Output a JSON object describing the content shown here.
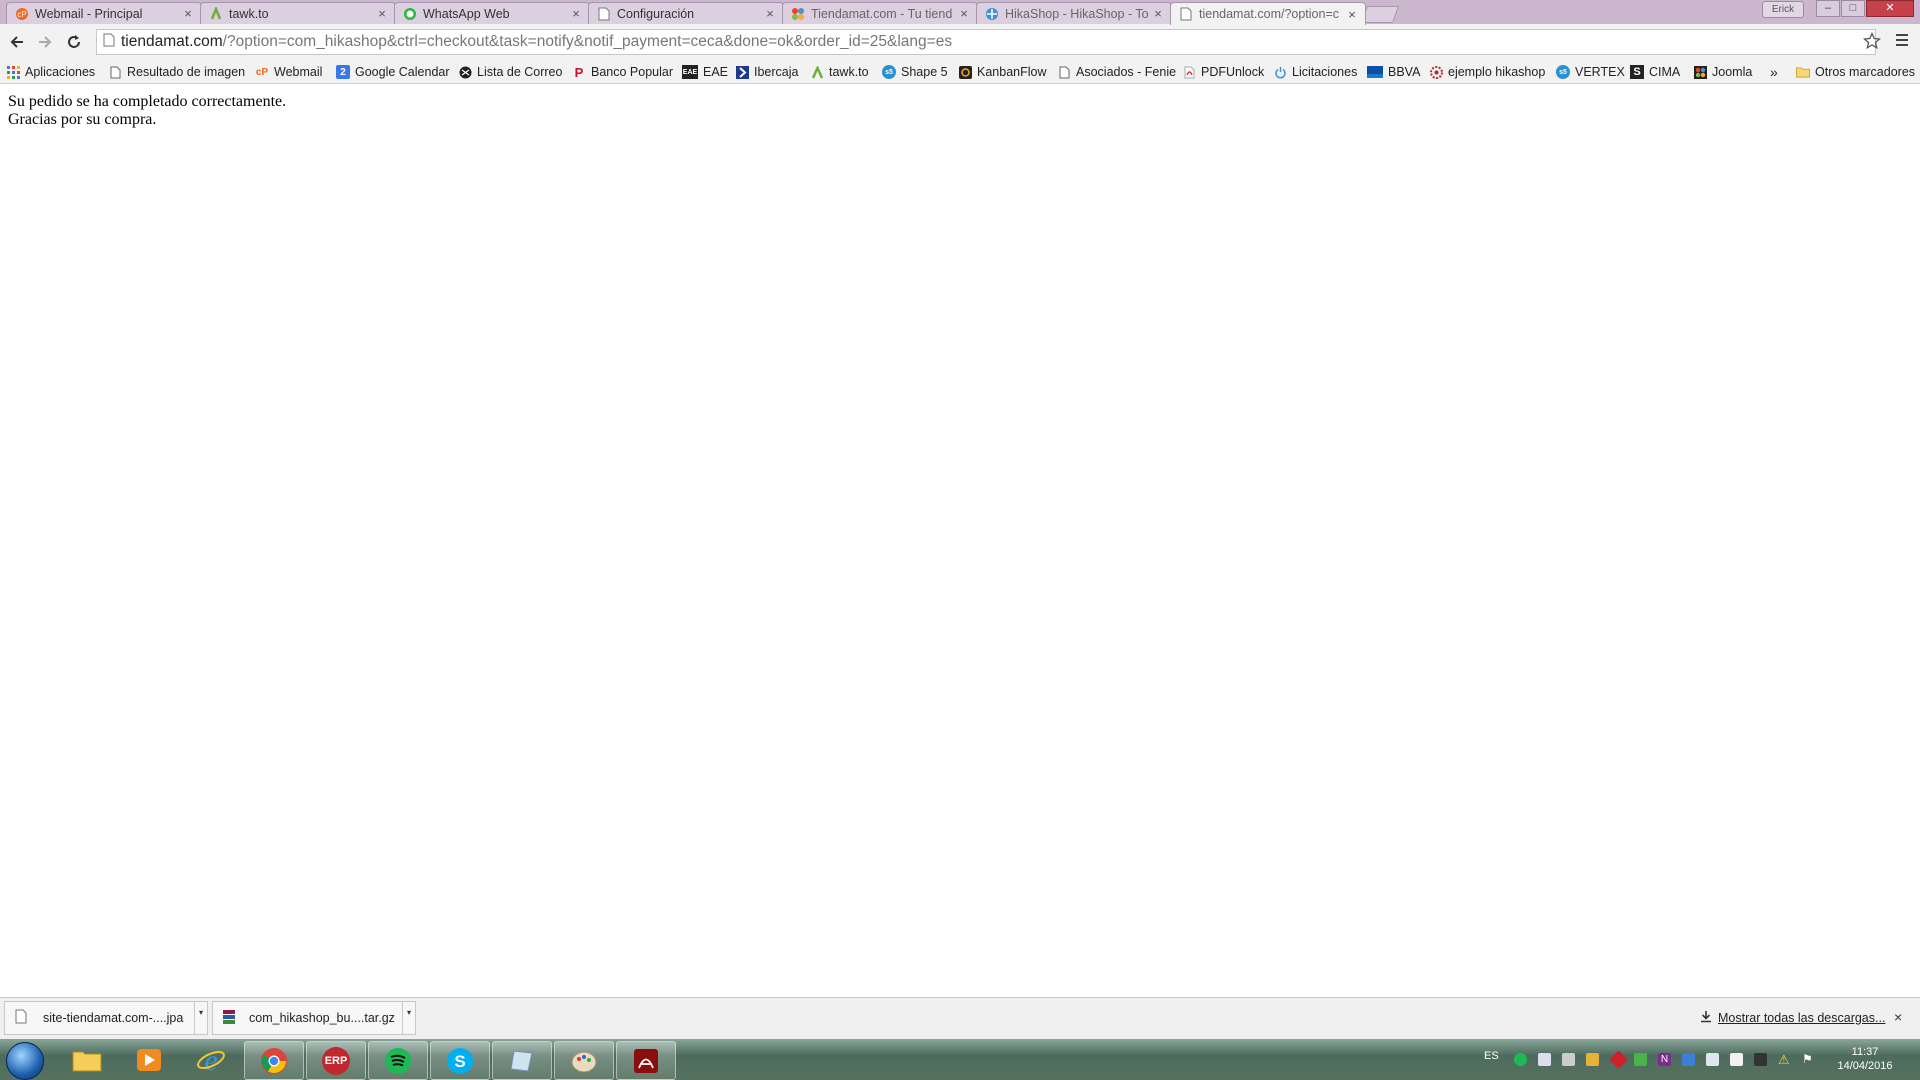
{
  "tabs": [
    {
      "title": "Webmail - Principal",
      "icon": "cp-webmail-icon",
      "close": "×"
    },
    {
      "title": "tawk.to",
      "icon": "tawk-icon",
      "close": "×"
    },
    {
      "title": "WhatsApp Web",
      "icon": "whatsapp-icon",
      "close": "×"
    },
    {
      "title": "Configuración",
      "icon": "page-icon",
      "close": "×"
    },
    {
      "title": "Tiendamat.com - Tu tiend",
      "icon": "joomla-icon",
      "close": "×"
    },
    {
      "title": "HikaShop - HikaShop - To",
      "icon": "hikashop-icon",
      "close": "×"
    },
    {
      "title": "tiendamat.com/?option=c",
      "icon": "page-icon",
      "close": "×"
    }
  ],
  "window": {
    "user": "Erick",
    "minimize": "–",
    "maximize": "□",
    "close": "✕"
  },
  "address": {
    "host": "tiendamat.com",
    "path": "/?option=com_hikashop&ctrl=checkout&task=notify&notif_payment=ceca&done=ok&order_id=25&lang=es"
  },
  "bookmarks": [
    {
      "label": "Aplicaciones",
      "icon": "apps-grid-icon"
    },
    {
      "label": "Resultado de imagen",
      "icon": "page-icon"
    },
    {
      "label": "Webmail",
      "icon": "cp-webmail-icon"
    },
    {
      "label": "Google Calendar",
      "icon": "calendar-icon",
      "glyph": "2"
    },
    {
      "label": "Lista de Correo",
      "icon": "mail-list-icon"
    },
    {
      "label": "Banco Popular",
      "icon": "banco-popular-icon",
      "glyph": "P"
    },
    {
      "label": "EAE",
      "icon": "eae-icon",
      "glyph": "EAE"
    },
    {
      "label": "Ibercaja",
      "icon": "ibercaja-icon"
    },
    {
      "label": "tawk.to",
      "icon": "tawk-icon"
    },
    {
      "label": "Shape 5",
      "icon": "shape5-icon",
      "glyph": "s5"
    },
    {
      "label": "KanbanFlow",
      "icon": "kanbanflow-icon"
    },
    {
      "label": "Asociados - Fenie",
      "icon": "page-icon"
    },
    {
      "label": "PDFUnlock",
      "icon": "pdf-icon"
    },
    {
      "label": "Licitaciones",
      "icon": "power-icon"
    },
    {
      "label": "BBVA",
      "icon": "bbva-icon"
    },
    {
      "label": "ejemplo hikashop",
      "icon": "hikashop-icon"
    },
    {
      "label": "VERTEX",
      "icon": "shape5-icon",
      "glyph": "s5"
    },
    {
      "label": "CIMA",
      "icon": "cima-icon",
      "glyph": "S"
    },
    {
      "label": "Joomla",
      "icon": "joomla-icon"
    }
  ],
  "bookmarks_overflow": "»",
  "other_bookmarks": "Otros marcadores",
  "content": {
    "line1": "Su pedido se ha completado correctamente.",
    "line2": "Gracias por su compra."
  },
  "downloads": {
    "items": [
      {
        "name": "site-tiendamat.com-....jpa",
        "icon": "file-icon"
      },
      {
        "name": "com_hikashop_bu....tar.gz",
        "icon": "winrar-archive-icon"
      }
    ],
    "show_all": "Mostrar todas las descargas...",
    "close": "×"
  },
  "taskbar": {
    "apps": [
      {
        "name": "explorer",
        "icon": "folder-icon"
      },
      {
        "name": "media",
        "icon": "media-player-icon"
      },
      {
        "name": "ie",
        "icon": "internet-explorer-icon"
      },
      {
        "name": "chrome",
        "icon": "chrome-icon",
        "running": true
      },
      {
        "name": "erp",
        "icon": "erp-icon",
        "glyph": "ERP",
        "running": true
      },
      {
        "name": "spotify",
        "icon": "spotify-icon",
        "running": true
      },
      {
        "name": "skype",
        "icon": "skype-icon",
        "running": true
      },
      {
        "name": "notes",
        "icon": "notepad-icon",
        "running": true
      },
      {
        "name": "paint",
        "icon": "paint-icon",
        "running": true
      },
      {
        "name": "acrobat",
        "icon": "acrobat-icon",
        "running": true
      }
    ],
    "language": "ES",
    "time": "11:37",
    "date": "14/04/2016"
  }
}
